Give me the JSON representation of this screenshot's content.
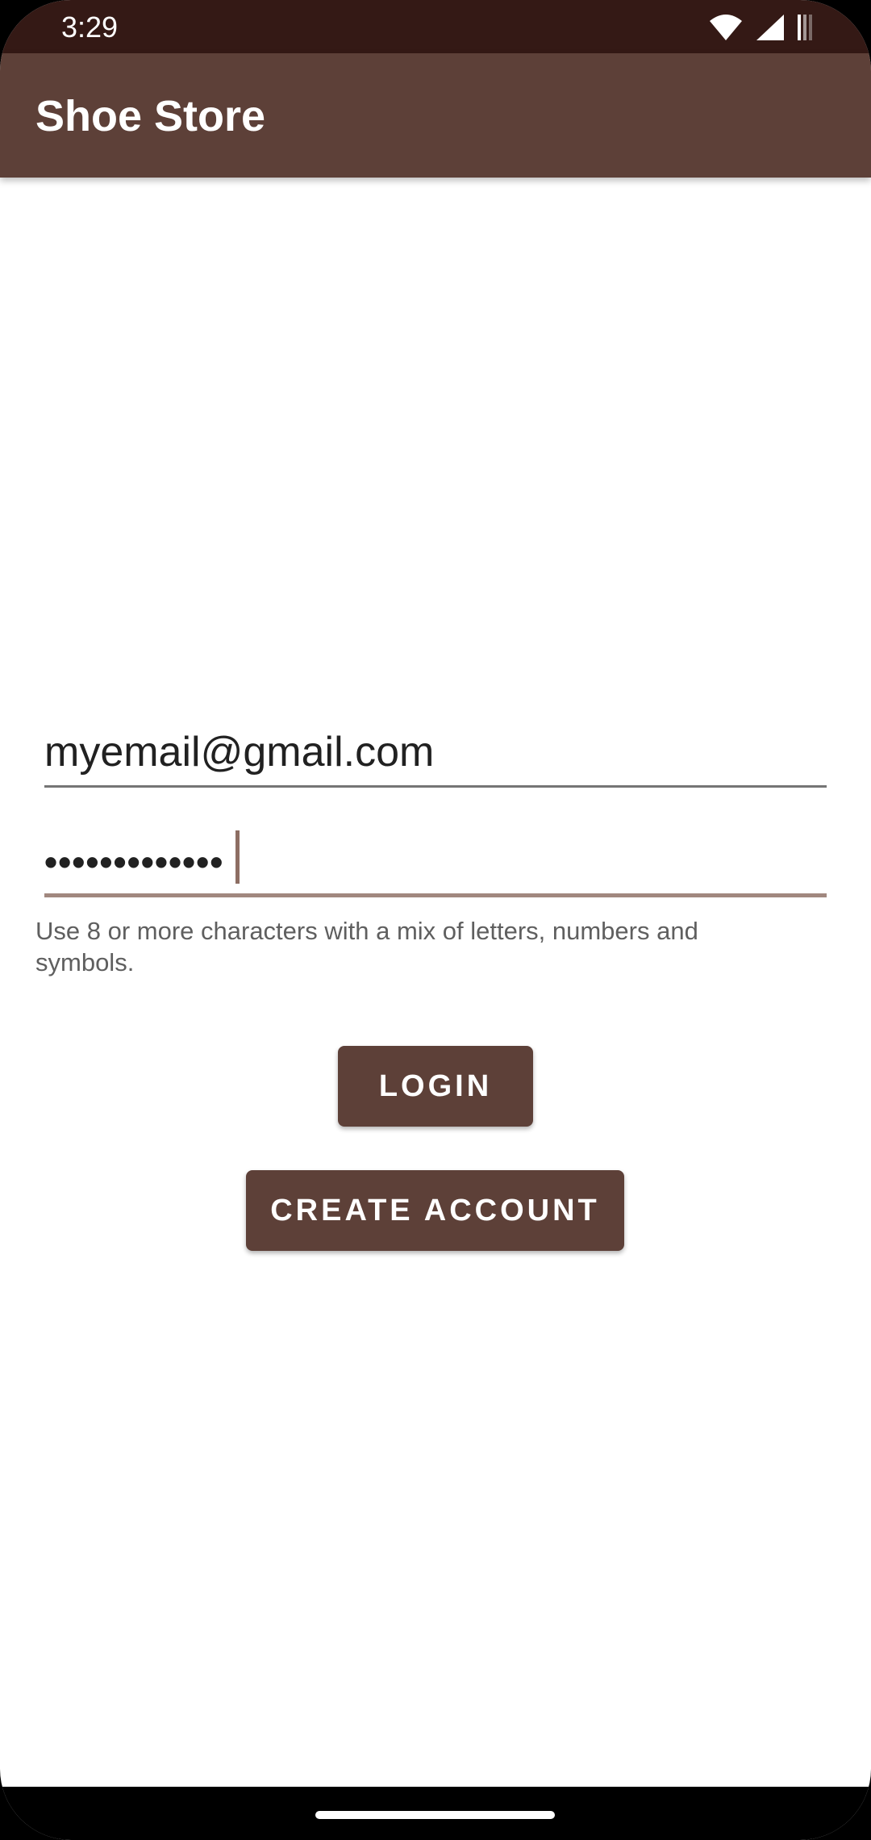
{
  "status_bar": {
    "time": "3:29",
    "icons": [
      "wifi-icon",
      "signal-icon",
      "battery-icon"
    ]
  },
  "app_bar": {
    "title": "Shoe Store"
  },
  "login_form": {
    "email_value": "myemail@gmail.com",
    "password_value": "•••••••••••••",
    "helper_text": "Use 8 or more characters with a mix of letters, numbers and symbols.",
    "login_label": "LOGIN",
    "create_account_label": "CREATE ACCOUNT"
  },
  "colors": {
    "primary": "#5d4038",
    "primary_dark": "#341915",
    "accent_underline": "#a1887f",
    "background": "#ffffff"
  }
}
